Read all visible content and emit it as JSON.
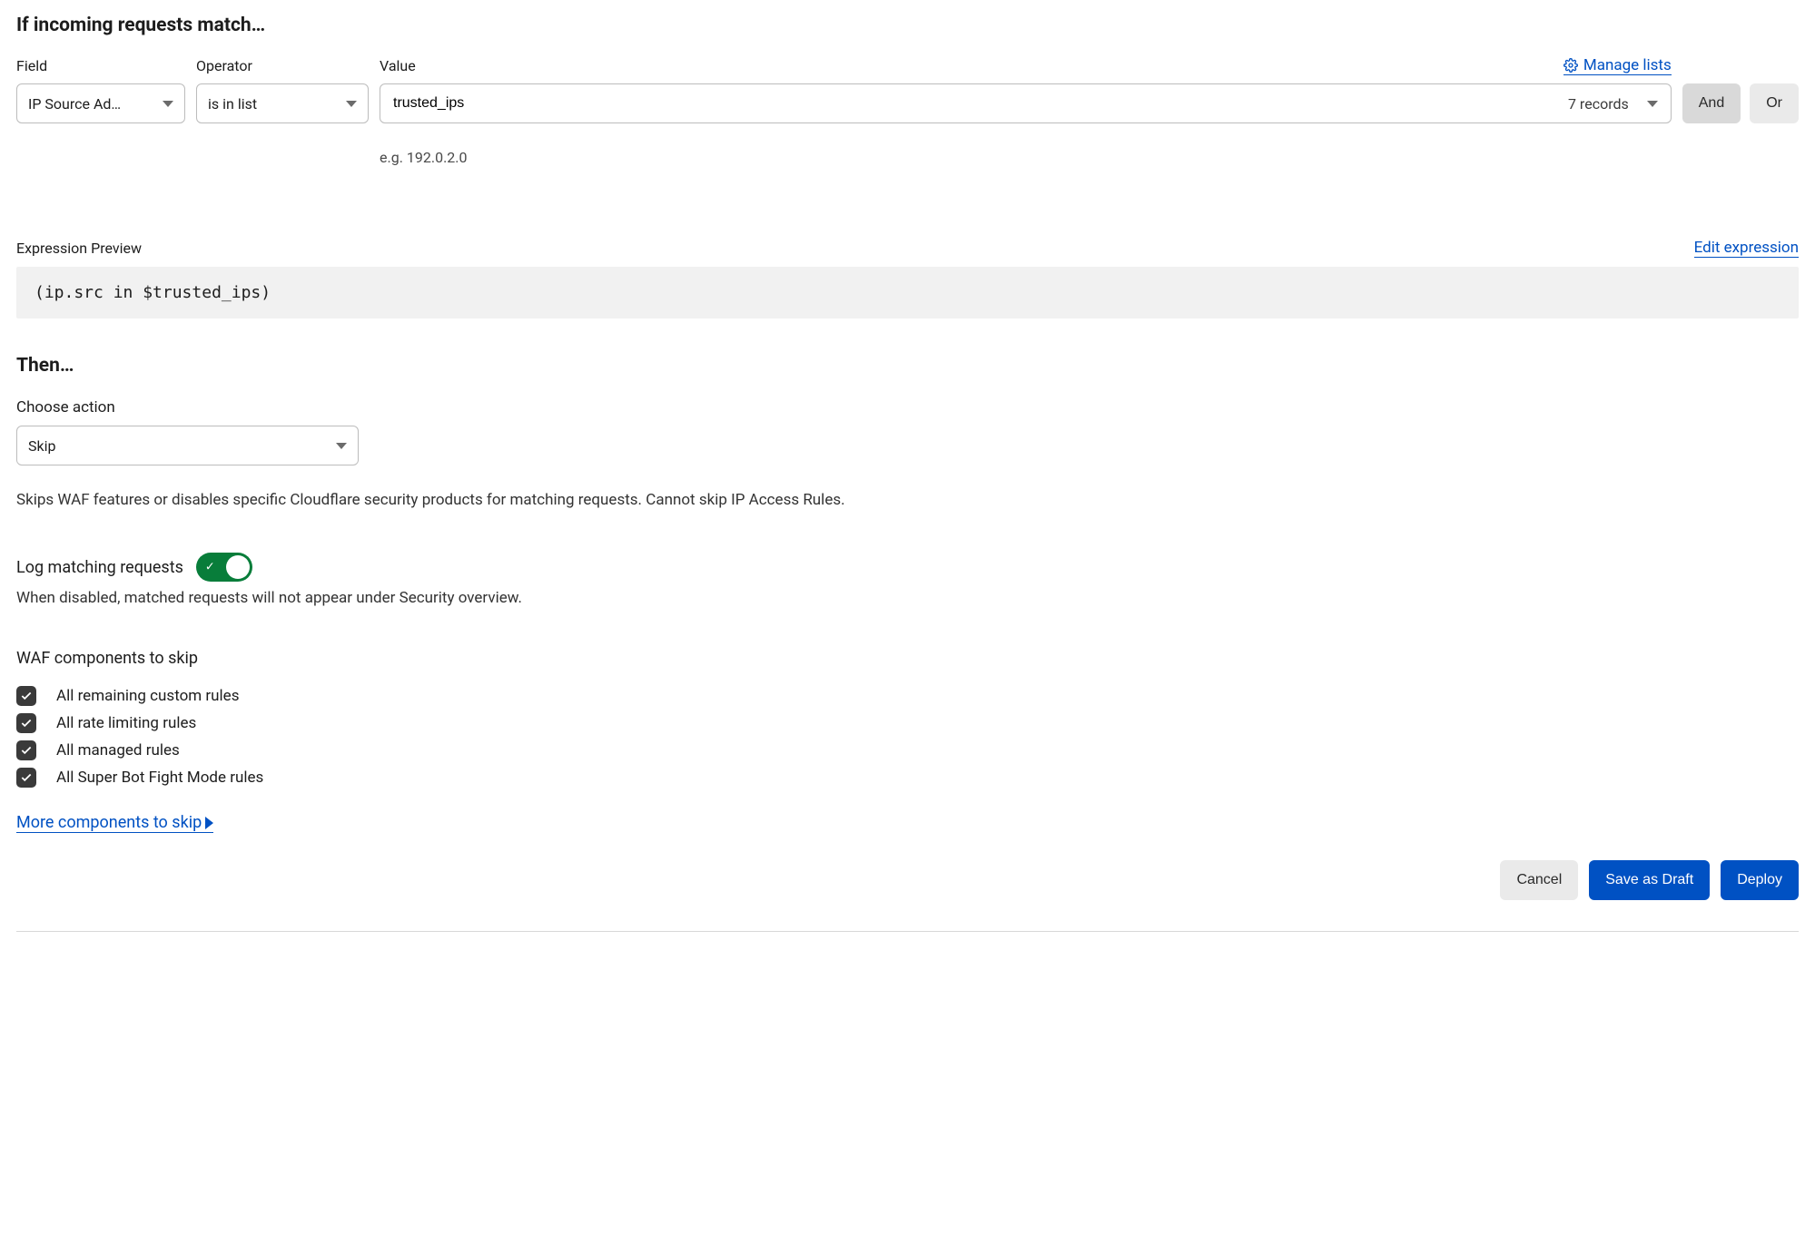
{
  "if_section": {
    "title": "If incoming requests match…",
    "labels": {
      "field": "Field",
      "operator": "Operator",
      "value": "Value"
    },
    "field_value": "IP Source Ad…",
    "operator_value": "is in list",
    "value_value": "trusted_ips",
    "records_text": "7 records",
    "hint": "e.g. 192.0.2.0",
    "manage_lists": "Manage lists",
    "and_label": "And",
    "or_label": "Or"
  },
  "expression": {
    "label": "Expression Preview",
    "edit_link": "Edit expression",
    "code": "(ip.src in $trusted_ips)"
  },
  "then": {
    "title": "Then…",
    "choose_action": "Choose action",
    "action_value": "Skip",
    "description": "Skips WAF features or disables specific Cloudflare security products for matching requests. Cannot skip IP Access Rules."
  },
  "log": {
    "label": "Log matching requests",
    "desc": "When disabled, matched requests will not appear under Security overview."
  },
  "waf": {
    "title": "WAF components to skip",
    "items": [
      "All remaining custom rules",
      "All rate limiting rules",
      "All managed rules",
      "All Super Bot Fight Mode rules"
    ],
    "more_link": "More components to skip"
  },
  "buttons": {
    "cancel": "Cancel",
    "save_draft": "Save as Draft",
    "deploy": "Deploy"
  }
}
